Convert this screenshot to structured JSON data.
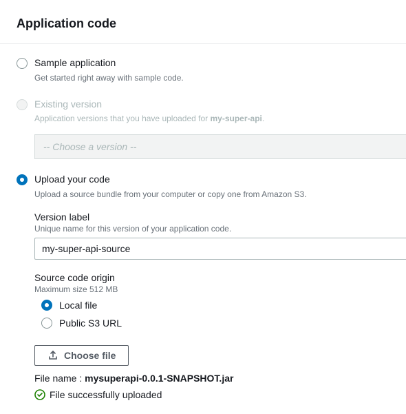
{
  "section_title": "Application code",
  "options": {
    "sample": {
      "label": "Sample application",
      "desc": "Get started right away with sample code."
    },
    "existing": {
      "label": "Existing version",
      "desc_prefix": "Application versions that you have uploaded for ",
      "app_name": "my-super-api",
      "desc_suffix": ".",
      "select_placeholder": "-- Choose a version --"
    },
    "upload": {
      "label": "Upload your code",
      "desc": "Upload a source bundle from your computer or copy one from Amazon S3.",
      "version_label": "Version label",
      "version_desc": "Unique name for this version of your application code.",
      "version_value": "my-super-api-source",
      "origin_label": "Source code origin",
      "origin_desc": "Maximum size 512 MB",
      "origin_local": "Local file",
      "origin_s3": "Public S3 URL",
      "choose_file": "Choose file",
      "file_name_label": "File name : ",
      "file_name": "mysuperapi-0.0.1-SNAPSHOT.jar",
      "success_msg": "File successfully uploaded"
    }
  }
}
